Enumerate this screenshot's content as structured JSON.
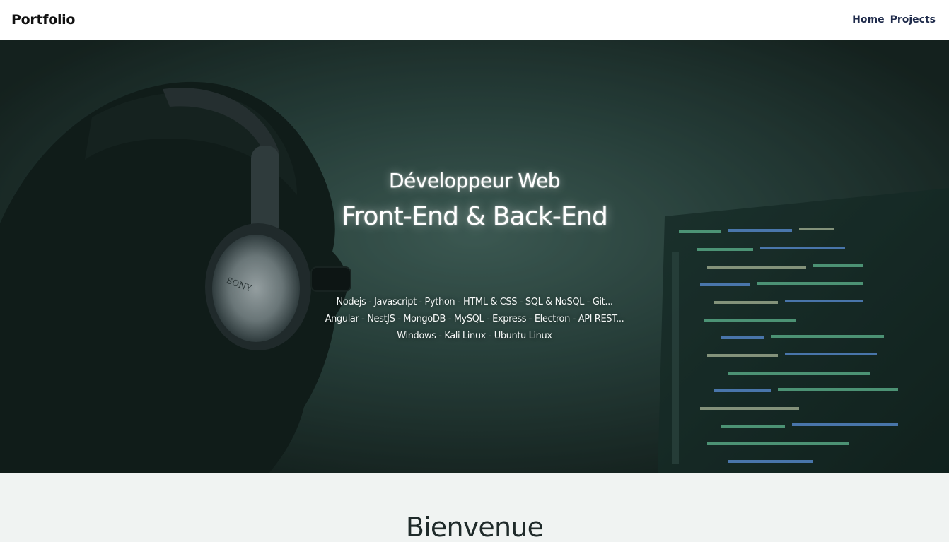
{
  "navbar": {
    "brand": "Portfolio",
    "links": [
      "Home",
      "Projects"
    ]
  },
  "hero": {
    "title": "Développeur Web",
    "subtitle": "Front-End & Back-End",
    "skills": [
      "Nodejs - Javascript - Python - HTML & CSS - SQL & NoSQL - Git...",
      "Angular - NestJS - MongoDB - MySQL - Express - Electron - API REST...",
      "Windows - Kali Linux - Ubuntu Linux"
    ],
    "headphone_brand": "SONY"
  },
  "section": {
    "title": "Bienvenue"
  },
  "colors": {
    "navbar_bg": "#ffffff",
    "nav_link": "#1e2a4a",
    "hero_tint": "#2a3f3b",
    "page_bg": "#f0f3f2",
    "code_green": "#6fd6a8",
    "code_blue": "#6aa7ff"
  }
}
